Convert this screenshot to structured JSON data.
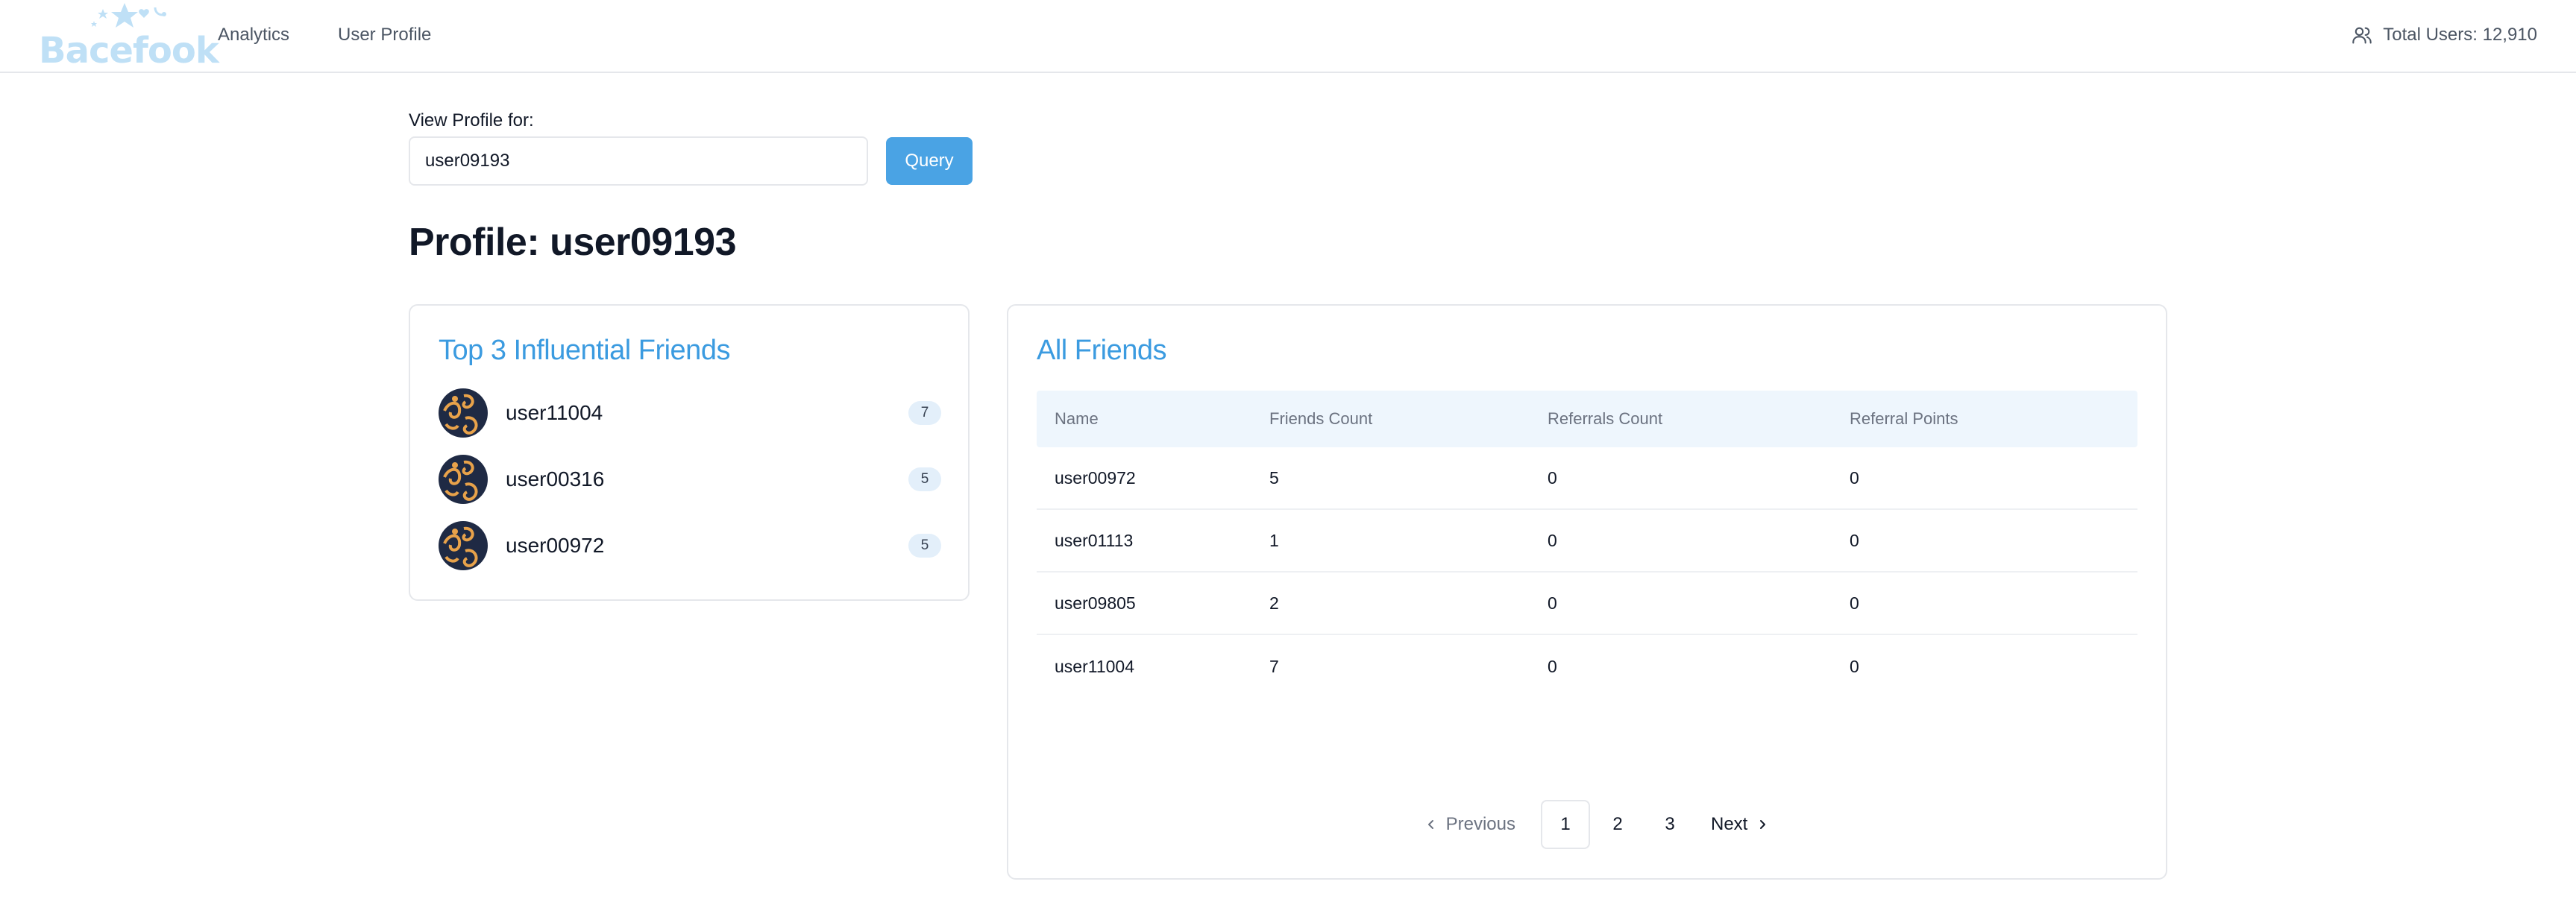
{
  "header": {
    "logo_text": "Bacefook",
    "nav": [
      {
        "label": "Analytics"
      },
      {
        "label": "User Profile"
      }
    ],
    "total_users": "Total Users: 12,910",
    "total_users_icon": "users-icon"
  },
  "query": {
    "label": "View Profile for:",
    "input_value": "user09193",
    "button_label": "Query"
  },
  "profile_title": "Profile: user09193",
  "top_friends": {
    "title": "Top 3 Influential Friends",
    "items": [
      {
        "name": "user11004",
        "count": "7"
      },
      {
        "name": "user00316",
        "count": "5"
      },
      {
        "name": "user00972",
        "count": "5"
      }
    ]
  },
  "all_friends": {
    "title": "All Friends",
    "columns": [
      "Name",
      "Friends Count",
      "Referrals Count",
      "Referral Points"
    ],
    "rows": [
      [
        "user00972",
        "5",
        "0",
        "0"
      ],
      [
        "user01113",
        "1",
        "0",
        "0"
      ],
      [
        "user09805",
        "2",
        "0",
        "0"
      ],
      [
        "user11004",
        "7",
        "0",
        "0"
      ]
    ]
  },
  "pagination": {
    "previous": "Previous",
    "pages": [
      "1",
      "2",
      "3"
    ],
    "current": "1",
    "next": "Next"
  },
  "colors": {
    "accent": "#4aa3e4",
    "title_blue": "#3b9be0",
    "logo": "#bfe0f6",
    "table_header_bg": "#eef6fd",
    "badge_bg": "#e3effa"
  }
}
